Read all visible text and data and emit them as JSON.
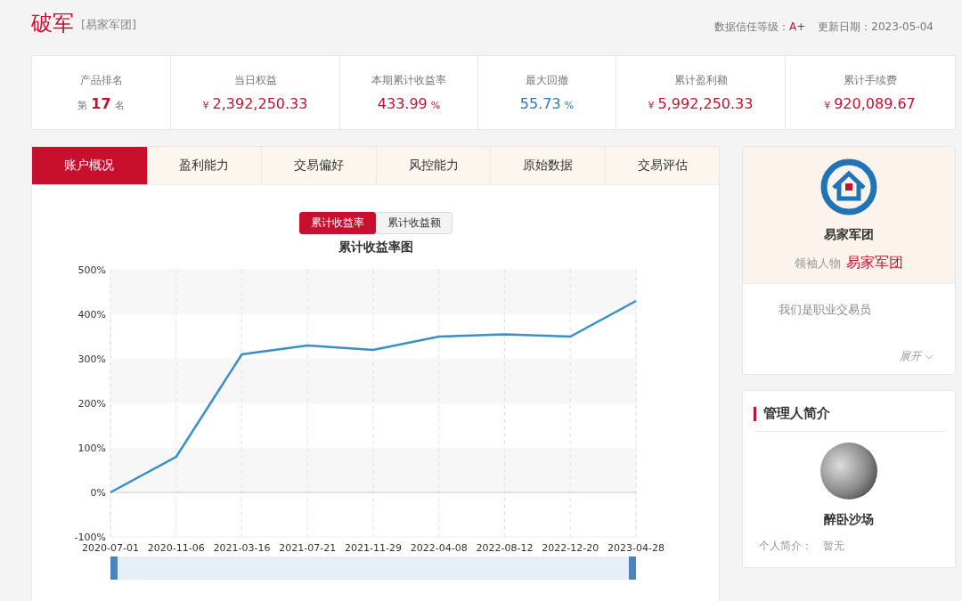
{
  "header": {
    "title": "破军",
    "subtitle": "[易家军团]",
    "trust_label": "数据信任等级：",
    "trust_value": "A+",
    "date_label": "更新日期：",
    "date_value": "2023-05-04"
  },
  "stats": [
    {
      "label": "产品排名",
      "prefix": "第",
      "value": "17",
      "suffix": "名",
      "color": "#c8102e",
      "kind": "rank"
    },
    {
      "label": "当日权益",
      "prefix": "¥",
      "value": "2,392,250.33",
      "color": "#c8102e",
      "kind": "money"
    },
    {
      "label": "本期累计收益率",
      "value": "433.99",
      "suffix": "%",
      "color": "#c8102e",
      "kind": "percent"
    },
    {
      "label": "最大回撤",
      "value": "55.73",
      "suffix": "%",
      "color": "#2a7ab8",
      "kind": "percent"
    },
    {
      "label": "累计盈利额",
      "prefix": "¥",
      "value": "5,992,250.33",
      "color": "#c8102e",
      "kind": "money"
    },
    {
      "label": "累计手续费",
      "prefix": "¥",
      "value": "920,089.67",
      "color": "#c8102e",
      "kind": "money"
    }
  ],
  "tabs": [
    {
      "label": "账户概况",
      "selected": true
    },
    {
      "label": "盈利能力",
      "selected": false
    },
    {
      "label": "交易偏好",
      "selected": false
    },
    {
      "label": "风控能力",
      "selected": false
    },
    {
      "label": "原始数据",
      "selected": false
    },
    {
      "label": "交易评估",
      "selected": false
    }
  ],
  "chart_toggle": [
    {
      "label": "累计收益率",
      "selected": true
    },
    {
      "label": "累计收益额",
      "selected": false
    }
  ],
  "chart_data": {
    "type": "line",
    "title": "累计收益率图",
    "ylim": [
      -100,
      500
    ],
    "grid": true,
    "yticks": [
      {
        "value": -100,
        "label": "-100%"
      },
      {
        "value": 0,
        "label": "0%"
      },
      {
        "value": 100,
        "label": "100%"
      },
      {
        "value": 200,
        "label": "200%"
      },
      {
        "value": 300,
        "label": "300%"
      },
      {
        "value": 400,
        "label": "400%"
      },
      {
        "value": 500,
        "label": "500%"
      }
    ],
    "categories": [
      "2020-07-01",
      "2020-11-06",
      "2021-03-16",
      "2021-07-21",
      "2021-11-29",
      "2022-04-08",
      "2022-08-12",
      "2022-12-20",
      "2023-04-28"
    ],
    "series": [
      {
        "color": "#3a8fc8",
        "values": [
          0,
          80,
          310,
          330,
          320,
          350,
          355,
          350,
          430
        ]
      }
    ]
  },
  "team": {
    "name": "易家军团",
    "leader_label": "领袖人物",
    "leader_name": "易家军团",
    "description": "我们是职业交易员",
    "expand": "展开"
  },
  "manager": {
    "heading": "管理人简介",
    "name": "醉卧沙场",
    "bio_label": "个人简介：",
    "bio_value": "暂无"
  }
}
